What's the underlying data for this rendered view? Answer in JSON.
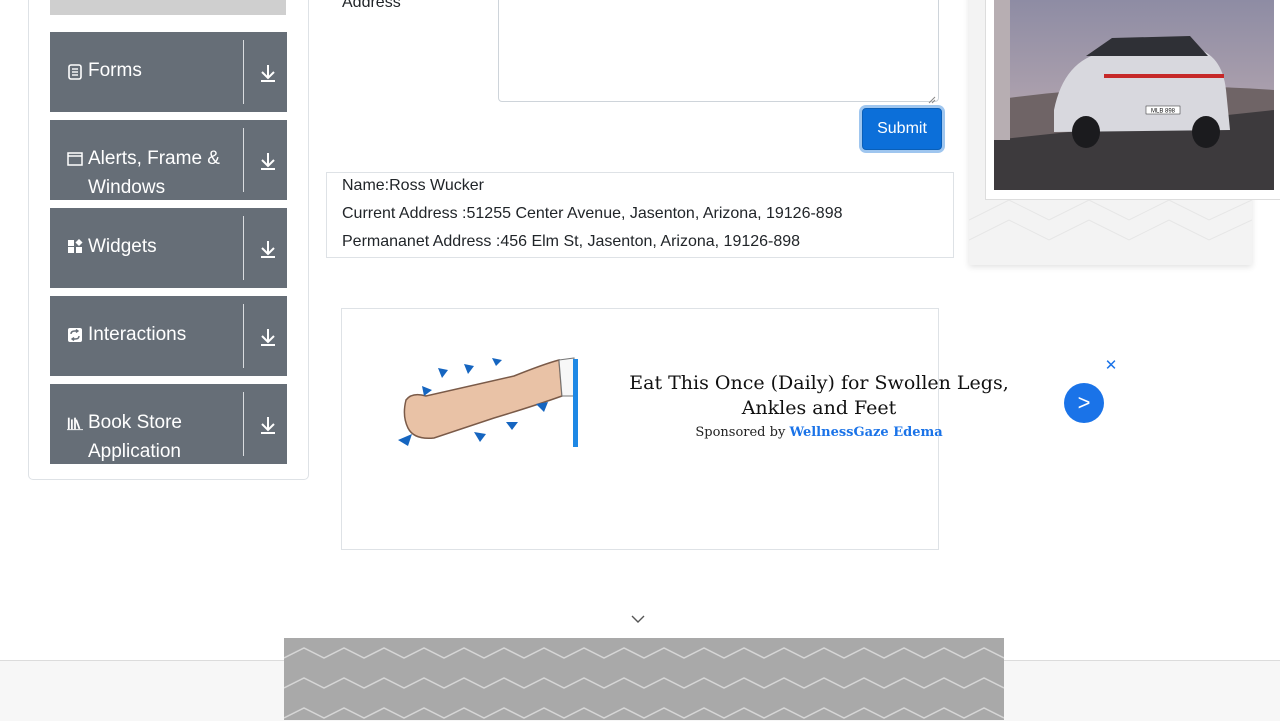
{
  "sidebar": {
    "items": [
      {
        "label": "Forms",
        "icon": "form-icon"
      },
      {
        "label": "Alerts, Frame & Windows",
        "icon": "window-icon"
      },
      {
        "label": "Widgets",
        "icon": "widgets-icon"
      },
      {
        "label": "Interactions",
        "icon": "interactions-icon"
      },
      {
        "label": "Book Store Application",
        "icon": "books-icon"
      }
    ]
  },
  "form": {
    "address_label": "Address",
    "submit_label": "Submit"
  },
  "output": {
    "name": "Name:Ross Wucker",
    "current_address": "Current Address :51255 Center Avenue, Jasenton, Arizona, 19126-898",
    "permanent_address": "Permananet Address :456 Elm St, Jasenton, Arizona, 19126-898"
  },
  "ad": {
    "headline": "Eat This Once (Daily) for Swollen Legs, Ankles and Feet",
    "sponsored_prefix": "Sponsored by",
    "sponsor": "WellnessGaze Edema",
    "close_glyph": "✕",
    "next_glyph": ">"
  },
  "right_panel": {
    "plate_text": "MLB 898"
  },
  "colors": {
    "sidebar_bg": "#666e77",
    "submit_bg": "#0c6fd9",
    "ad_accent": "#1a73e8"
  }
}
